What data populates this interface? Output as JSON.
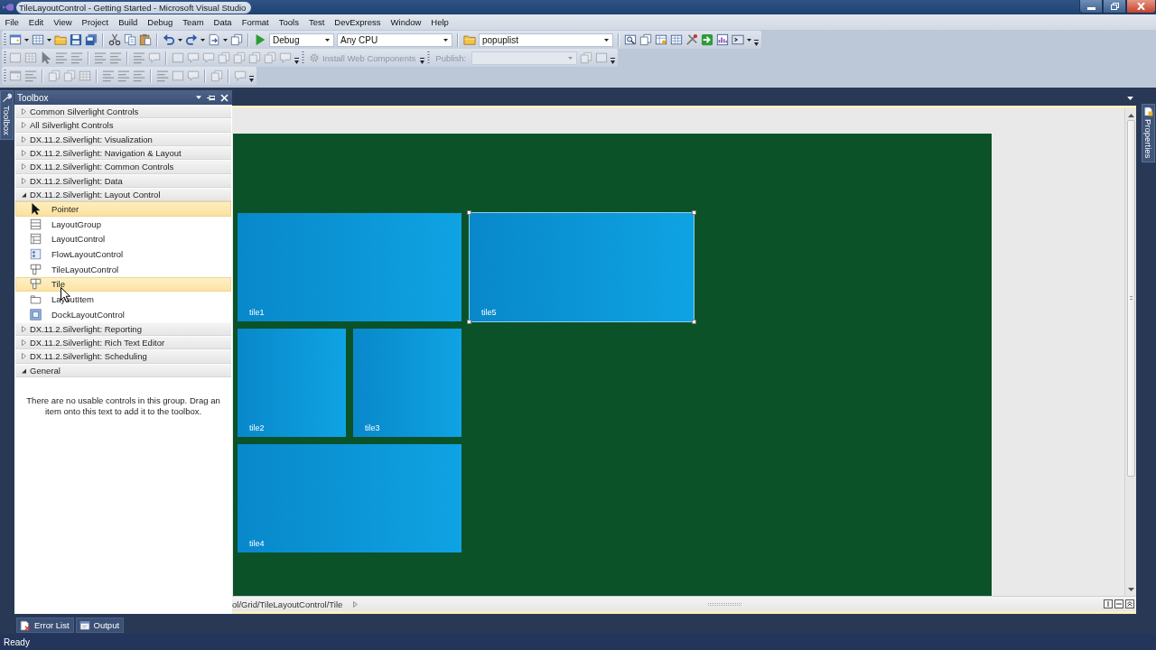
{
  "window": {
    "title": "TileLayoutControl - Getting Started - Microsoft Visual Studio"
  },
  "menu": [
    "File",
    "Edit",
    "View",
    "Project",
    "Build",
    "Debug",
    "Team",
    "Data",
    "Format",
    "Tools",
    "Test",
    "DevExpress",
    "Window",
    "Help"
  ],
  "toolbars": [
    {
      "disabled": false,
      "combos": [
        "Debug",
        "Any CPU",
        "popuplist"
      ]
    },
    {
      "disabled": true,
      "button": "Install Web Components",
      "label": "Publish:"
    },
    {
      "disabled": true
    }
  ],
  "side_tabs": {
    "left": "Toolbox",
    "right": "Properties"
  },
  "toolbox": {
    "title": "Toolbox",
    "groups": [
      {
        "label": "Common Silverlight Controls",
        "expanded": false
      },
      {
        "label": "All Silverlight Controls",
        "expanded": false
      },
      {
        "label": "DX.11.2.Silverlight: Visualization",
        "expanded": false
      },
      {
        "label": "DX.11.2.Silverlight: Navigation & Layout",
        "expanded": false
      },
      {
        "label": "DX.11.2.Silverlight: Common Controls",
        "expanded": false
      },
      {
        "label": "DX.11.2.Silverlight: Data",
        "expanded": false
      },
      {
        "label": "DX.11.2.Silverlight: Layout Control",
        "expanded": true,
        "items": [
          {
            "label": "Pointer",
            "selected": true,
            "hovered": false
          },
          {
            "label": "LayoutGroup",
            "selected": false,
            "hovered": false
          },
          {
            "label": "LayoutControl",
            "selected": false,
            "hovered": false
          },
          {
            "label": "FlowLayoutControl",
            "selected": false,
            "hovered": false
          },
          {
            "label": "TileLayoutControl",
            "selected": false,
            "hovered": false
          },
          {
            "label": "Tile",
            "selected": false,
            "hovered": true
          },
          {
            "label": "LayoutItem",
            "selected": false,
            "hovered": false
          },
          {
            "label": "DockLayoutControl",
            "selected": false,
            "hovered": false
          }
        ]
      },
      {
        "label": "DX.11.2.Silverlight: Reporting",
        "expanded": false
      },
      {
        "label": "DX.11.2.Silverlight: Rich Text Editor",
        "expanded": false
      },
      {
        "label": "DX.11.2.Silverlight: Scheduling",
        "expanded": false
      },
      {
        "label": "General",
        "expanded": true,
        "empty_message": "There are no usable controls in this group. Drag an item onto this text to add it to the toolbox."
      }
    ]
  },
  "designer": {
    "columns": [
      {
        "tiles": [
          {
            "label": "tile1",
            "kind": "large",
            "selected": false
          },
          {
            "label": "tile2",
            "kind": "small",
            "selected": false
          },
          {
            "label": "tile3",
            "kind": "small",
            "selected": false
          },
          {
            "label": "tile4",
            "kind": "large",
            "selected": false
          }
        ]
      },
      {
        "tiles": [
          {
            "label": "tile5",
            "kind": "large",
            "selected": true
          }
        ]
      }
    ],
    "breadcrumb": "ol/Grid/TileLayoutControl/Tile"
  },
  "bottom_tabs": [
    "Error List",
    "Output"
  ],
  "status_bar": {
    "text": "Ready"
  }
}
